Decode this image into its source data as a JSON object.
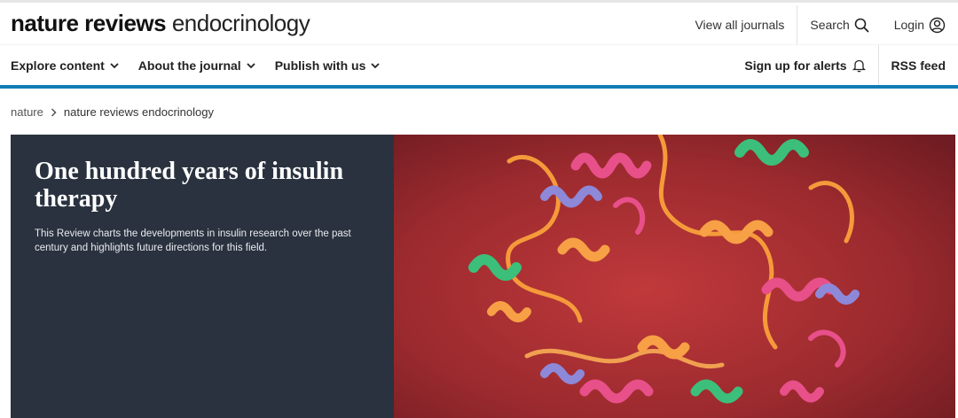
{
  "header": {
    "logo_bold": "nature reviews",
    "logo_light": "endocrinology",
    "view_all_journals": "View all journals",
    "search_label": "Search",
    "login_label": "Login"
  },
  "nav": {
    "items": [
      {
        "label": "Explore content"
      },
      {
        "label": "About the journal"
      },
      {
        "label": "Publish with us"
      }
    ],
    "signup_label": "Sign up for alerts",
    "rss_label": "RSS feed"
  },
  "breadcrumb": {
    "home": "nature",
    "current": "nature reviews endocrinology"
  },
  "hero": {
    "title": "One hundred years of insulin therapy",
    "description": "This Review charts the developments in insulin research over the past century and highlights future directions for this field.",
    "image_subject": "insulin protein ribbon structure",
    "panel_color": "#2a323f",
    "image_bg_color": "#9b2a2e"
  },
  "colors": {
    "accent_rule": "#0f7bb5"
  }
}
